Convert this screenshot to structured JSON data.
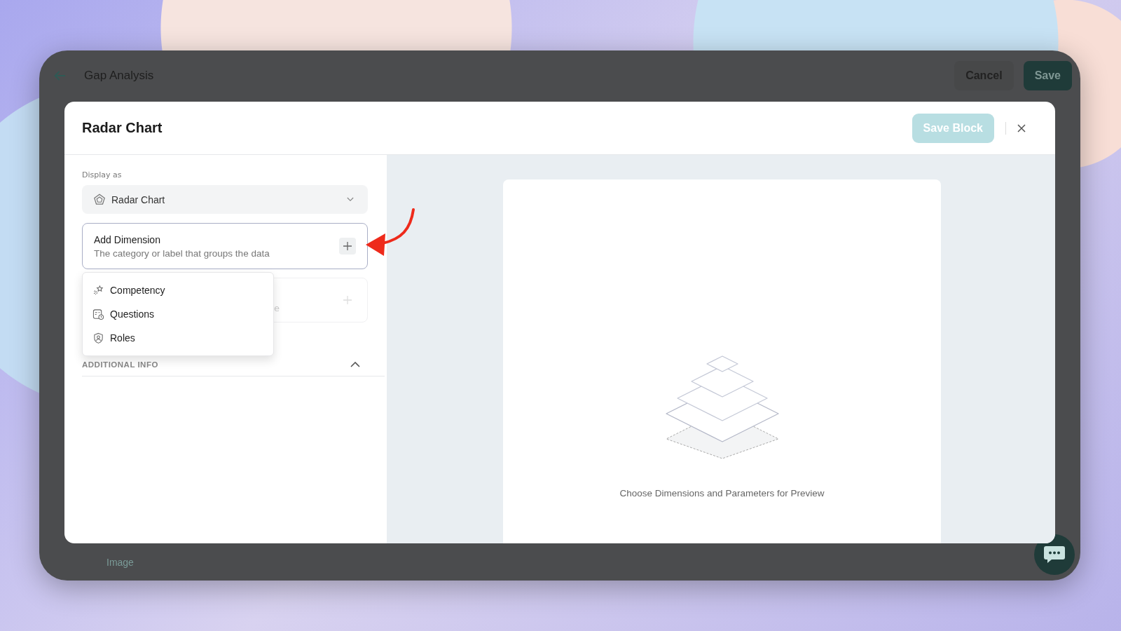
{
  "app_bar": {
    "title": "Gap Analysis",
    "buttons": [
      {
        "label": "Cancel",
        "kind": "secondary"
      },
      {
        "label": "Save",
        "kind": "primary"
      }
    ]
  },
  "modal": {
    "title": "Radar Chart",
    "save_button": {
      "label": "Save Block",
      "disabled": true
    },
    "display_as": {
      "label": "Display as",
      "value": "Radar Chart"
    },
    "dimension_card": {
      "title": "Add Dimension",
      "description": "The category or label that groups the data"
    },
    "hidden_card": {
      "text_fragment": "e"
    },
    "dropdown": [
      {
        "label": "Competency",
        "kind": "competency"
      },
      {
        "label": "Questions",
        "kind": "questions"
      },
      {
        "label": "Roles",
        "kind": "roles"
      }
    ],
    "section": {
      "label": "ADDITIONAL INFO",
      "expanded": true
    },
    "preview": {
      "message": "Choose Dimensions and Parameters for Preview"
    }
  },
  "background_page": {
    "caption": "Image"
  }
}
